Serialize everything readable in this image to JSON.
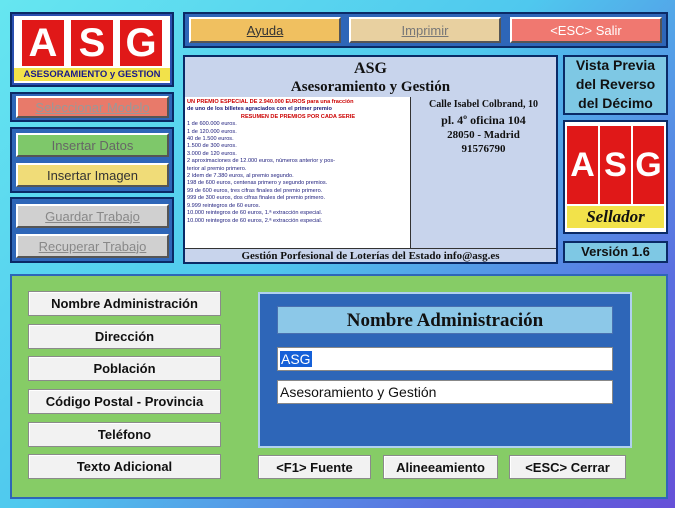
{
  "toolbar": {
    "help": "Ayuda",
    "print": "Imprimir",
    "exit": "<ESC> Salir"
  },
  "logo": {
    "letters": [
      "A",
      "S",
      "G"
    ],
    "caption": "ASESORAMIENTO y GESTION"
  },
  "left": {
    "select_model": "Seleccionar Modelo",
    "insert_data": "Insertar Datos",
    "insert_image": "Insertar Imagen",
    "save_work": "Guardar Trabajo",
    "recover_work": "Recuperar Trabajo"
  },
  "preview": {
    "title": "ASG",
    "subtitle": "Asesoramiento y Gestión",
    "address1": "Calle Isabel Colbrand, 10",
    "address2": "pl. 4º oficina 104",
    "address3": "28050 - Madrid",
    "phone": "91576790",
    "footer": "Gestión Porfesional de Loterías del Estado info@asg.es",
    "prize_lines": [
      {
        "t": "UN PREMIO ESPECIAL DE 2.940.000 EUROS para una fracción",
        "red": true
      },
      {
        "t": "de uno de los billetes agraciados con el primer premio",
        "red": false
      },
      {
        "t": "RESUMEN DE PREMIOS POR CADA SERIE",
        "red": true
      },
      {
        "t": "1 de 600.000 euros.",
        "red": false
      },
      {
        "t": "1 de 120.000 euros.",
        "red": false
      },
      {
        "t": "40 de    1.500 euros.",
        "red": false
      },
      {
        "t": "1.500 de      300 euros.",
        "red": false
      },
      {
        "t": "3.000 de      120 euros.",
        "red": false
      },
      {
        "t": "2 aproximaciones de 12.000 euros, números anterior y pos-",
        "red": false
      },
      {
        "t": "terior al premio primero.",
        "red": false
      },
      {
        "t": "2 ídem de 7.380 euros, al premio segundo.",
        "red": false
      },
      {
        "t": "198 de 600 euros, centenas primero y segundo premios.",
        "red": false
      },
      {
        "t": "99 de 600 euros, tres cifras finales del premio primero.",
        "red": false
      },
      {
        "t": "999 de 300 euros, dos cifras finales del premio primero.",
        "red": false
      },
      {
        "t": "9.999 reintegros de 60 euros.",
        "red": false
      },
      {
        "t": "10.000 reintegros de 60 euros, 1.ª extracción especial.",
        "red": false
      },
      {
        "t": "10.000 reintegros de 60 euros, 2.ª extracción especial.",
        "red": false
      }
    ]
  },
  "right": {
    "heading": "Vista Previa del Reverso del Décimo",
    "stamp_letters": [
      "A",
      "S",
      "G"
    ],
    "stamp_caption": "Sellador",
    "version": "Versión 1.6"
  },
  "form_buttons": {
    "admin_name": "Nombre Administración",
    "address": "Dirección",
    "town": "Población",
    "postal": "Código Postal - Provincia",
    "phone": "Teléfono",
    "extra_text": "Texto Adicional"
  },
  "editor": {
    "title": "Nombre Administración",
    "line1": "ASG",
    "line2": "Asesoramiento y Gestión",
    "font_btn": "<F1> Fuente",
    "align_btn": "Alineeamiento",
    "close_btn": "<ESC> Cerrar"
  },
  "colors": {
    "accent_red": "#e01818",
    "panel_blue": "#2e66b8",
    "form_green": "#86cc66"
  }
}
